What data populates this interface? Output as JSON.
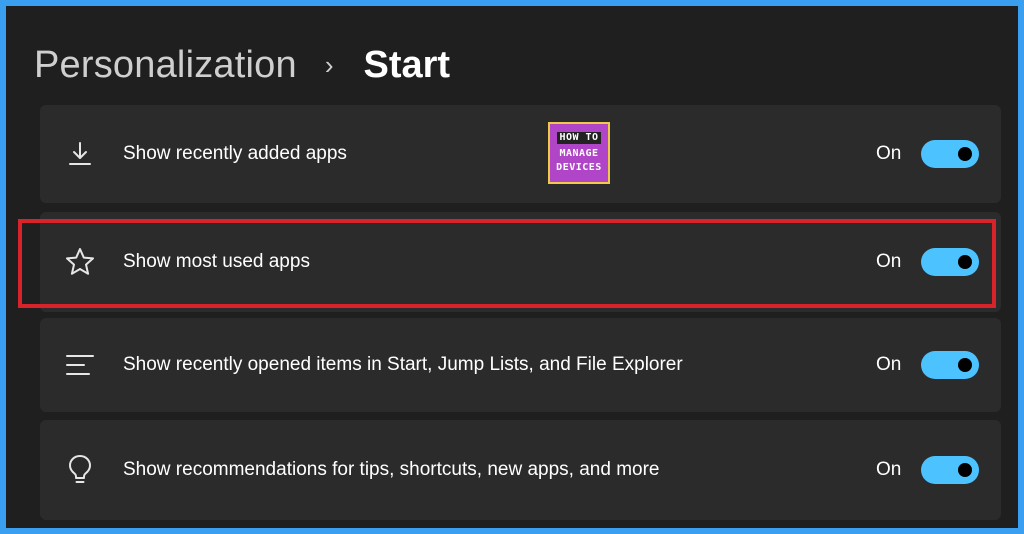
{
  "breadcrumb": {
    "parent": "Personalization",
    "separator": "›",
    "current": "Start"
  },
  "logo": {
    "line1": "HOW TO",
    "line2": "MANAGE",
    "line3": "DEVICES"
  },
  "settings": [
    {
      "label": "Show recently added apps",
      "icon": "download-icon",
      "state": "On",
      "enabled": true
    },
    {
      "label": "Show most used apps",
      "icon": "star-icon",
      "state": "On",
      "enabled": true,
      "highlighted": true
    },
    {
      "label": "Show recently opened items in Start, Jump Lists, and File Explorer",
      "icon": "list-lines-icon",
      "state": "On",
      "enabled": true
    },
    {
      "label": "Show recommendations for tips, shortcuts, new apps, and more",
      "icon": "lightbulb-icon",
      "state": "On",
      "enabled": true
    }
  ],
  "colors": {
    "accent": "#4cc2ff",
    "highlight_border": "#d9232a",
    "frame_border": "#3a9ff0",
    "card_bg": "#2b2b2b",
    "window_bg": "#1f1f1f"
  }
}
